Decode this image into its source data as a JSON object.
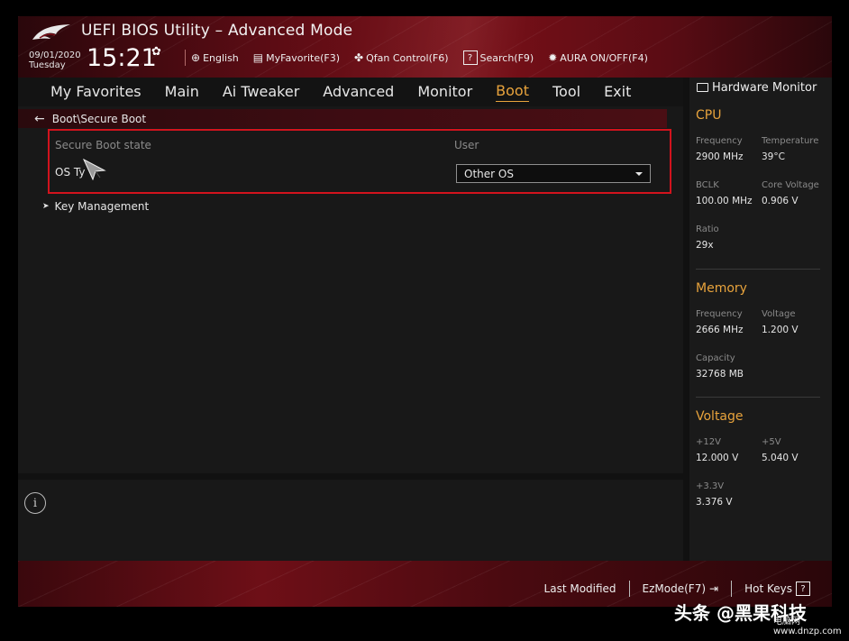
{
  "header": {
    "title": "UEFI BIOS Utility – Advanced Mode",
    "date": "09/01/2020",
    "day": "Tuesday",
    "time": "15:21",
    "toolbar": [
      {
        "label": "English",
        "icon": "globe-icon"
      },
      {
        "label": "MyFavorite(F3)",
        "icon": "favorite-icon"
      },
      {
        "label": "Qfan Control(F6)",
        "icon": "fan-icon"
      },
      {
        "label": "Search(F9)",
        "icon": "search-help-icon"
      },
      {
        "label": "AURA ON/OFF(F4)",
        "icon": "aura-icon"
      }
    ]
  },
  "nav": {
    "tabs": [
      "My Favorites",
      "Main",
      "Ai Tweaker",
      "Advanced",
      "Monitor",
      "Boot",
      "Tool",
      "Exit"
    ],
    "active": "Boot"
  },
  "main": {
    "breadcrumb": "Boot\\Secure Boot",
    "secure_boot_state_label": "Secure Boot state",
    "secure_boot_state_value": "User",
    "os_type_label": "OS Ty",
    "os_type_value": "Other OS",
    "key_management": "Key Management"
  },
  "hardware_monitor": {
    "title": "Hardware Monitor",
    "cpu": {
      "title": "CPU",
      "frequency_label": "Frequency",
      "frequency": "2900 MHz",
      "temperature_label": "Temperature",
      "temperature": "39°C",
      "bclk_label": "BCLK",
      "bclk": "100.00 MHz",
      "core_voltage_label": "Core Voltage",
      "core_voltage": "0.906 V",
      "ratio_label": "Ratio",
      "ratio": "29x"
    },
    "memory": {
      "title": "Memory",
      "frequency_label": "Frequency",
      "frequency": "2666 MHz",
      "voltage_label": "Voltage",
      "voltage": "1.200 V",
      "capacity_label": "Capacity",
      "capacity": "32768 MB"
    },
    "voltage": {
      "title": "Voltage",
      "v12_label": "+12V",
      "v12": "12.000 V",
      "v5_label": "+5V",
      "v5": "5.040 V",
      "v33_label": "+3.3V",
      "v33": "3.376 V"
    }
  },
  "footer": {
    "last_modified": "Last Modified",
    "ezmode": "EzMode(F7)",
    "hotkeys": "Hot Keys",
    "hotkeys_icon_glyph": "?"
  },
  "watermark": {
    "text": "头条 @黑果科技",
    "site": "电脑网 www.dnzp.com"
  },
  "colors": {
    "accent": "#e8a33c",
    "highlight_border": "#d2131d",
    "header_red": "#7a1018"
  }
}
